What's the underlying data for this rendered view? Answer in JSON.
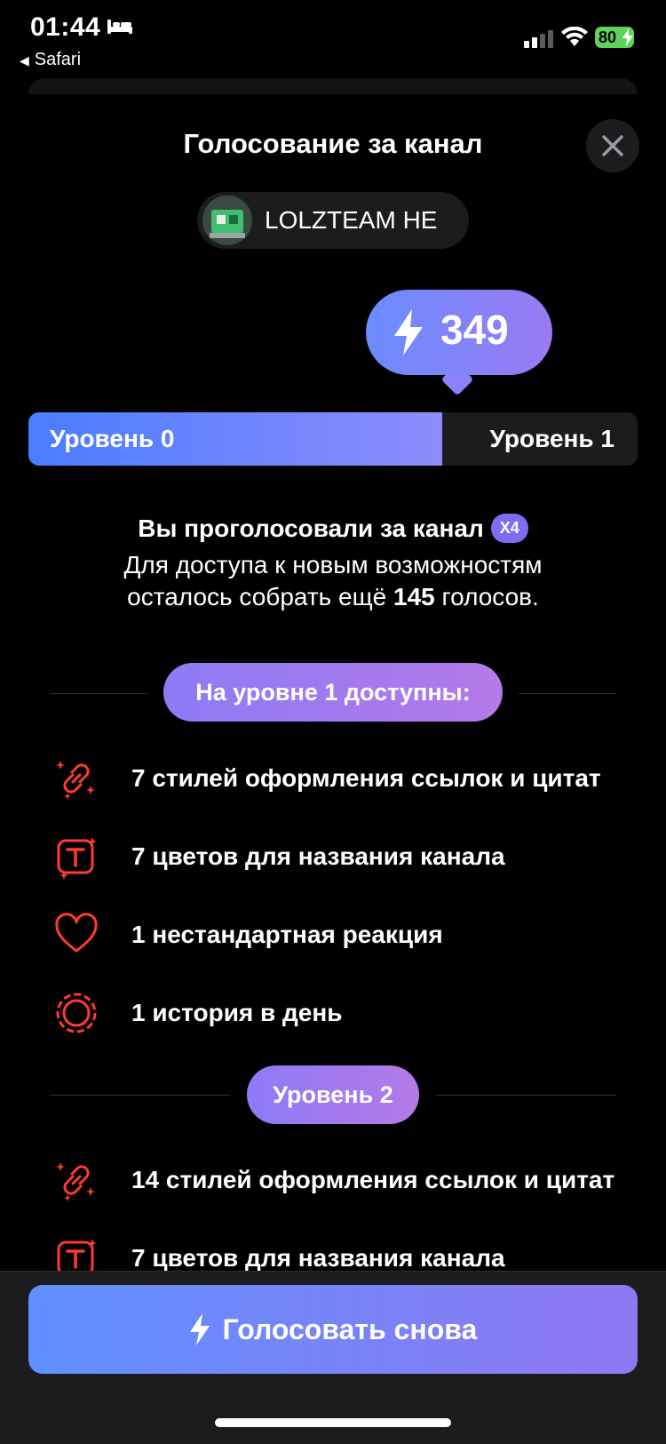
{
  "status_bar": {
    "time": "01:44",
    "back_app": "Safari",
    "battery": "80"
  },
  "header": {
    "title": "Голосование за канал"
  },
  "channel": {
    "name": "LOLZTEAM HE"
  },
  "votes": {
    "count": "349"
  },
  "level_bar": {
    "current": "Уровень 0",
    "next": "Уровень 1",
    "progress": 0.68
  },
  "info": {
    "voted": "Вы проголосовали за канал",
    "boost_badge": "X4",
    "line2": "Для доступа к новым возможностям",
    "line3_prefix": "осталось собрать ещё ",
    "line3_count": "145",
    "line3_suffix": " голосов."
  },
  "sections": [
    {
      "title": "На уровне 1 доступны:",
      "features": [
        {
          "icon": "link-sparkle-icon",
          "label": "7 стилей оформления ссылок и цитат"
        },
        {
          "icon": "text-color-icon",
          "label": "7 цветов для названия канала"
        },
        {
          "icon": "heart-icon",
          "label": "1 нестандартная реакция"
        },
        {
          "icon": "story-circle-icon",
          "label": "1 история в день"
        }
      ]
    },
    {
      "title": "Уровень 2",
      "features": [
        {
          "icon": "link-sparkle-icon",
          "label": "14 стилей оформления ссылок и цитат"
        },
        {
          "icon": "text-color-icon",
          "label": "7 цветов для названия канала"
        }
      ]
    }
  ],
  "button": {
    "vote_again": "Голосовать снова"
  },
  "colors": {
    "accent_red": "#ff3b30",
    "gradient_start": "#5f90ff",
    "gradient_end": "#9a7bf2"
  }
}
